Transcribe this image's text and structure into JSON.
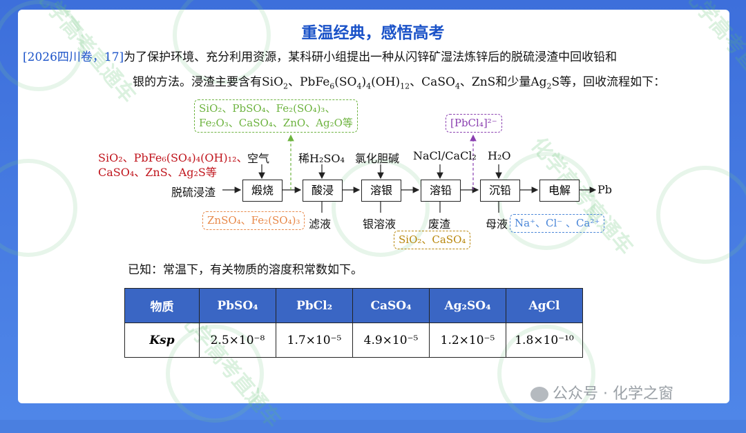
{
  "title": "重温经典，感悟高考",
  "question": {
    "source": "[2026四川卷，17]",
    "line1": "为了保护环境、充分利用资源，某科研小组提出一种从闪锌矿湿法炼锌后的脱硫浸渣中回收铅和",
    "line2_a": "银的方法。浸渣主要含有SiO",
    "line2_b": "、PbFe",
    "line2_c": "(SO",
    "line2_d": ")",
    "line2_e": "(OH)",
    "line2_f": "、CaSO",
    "line2_g": "、ZnS和少量Ag",
    "line2_h": "S等，回收流程如下："
  },
  "flow": {
    "feed_label": "脱硫浸渣",
    "product": "Pb",
    "steps": [
      "煅烧",
      "酸浸",
      "溶银",
      "溶铅",
      "沉铅",
      "电解"
    ],
    "reagents": [
      "空气",
      "稀H₂SO₄",
      "氯化胆碱",
      "NaCl/CaCl₂",
      "H₂O"
    ],
    "outputs": [
      "滤液",
      "银溶液",
      "废渣",
      "母液"
    ],
    "feed_components": [
      "SiO₂、PbFe₆(SO₄)₄(OH)₁₂、",
      "CaSO₄、ZnS、Ag₂S等"
    ],
    "annot_calcine": [
      "SiO₂、PbSO₄、Fe₂(SO₄)₃、",
      "Fe₂O₃、CaSO₄、ZnO、Ag₂O等"
    ],
    "annot_leach": "ZnSO₄、Fe₂(SO₄)₃",
    "annot_residue": "SiO₂、CaSO₄",
    "annot_complex": "[PbCl₄]²⁻",
    "annot_mother": "Na⁺、Cl⁻ 、Ca²⁺",
    "colors": {
      "feed": "#c0141c",
      "calcine": "#6db33f",
      "leach": "#e8894a",
      "residue": "#b8860b",
      "complex": "#8a3fb0",
      "mother": "#4a86d8"
    }
  },
  "known": "已知：常温下，有关物质的溶度积常数如下。",
  "table": {
    "headers": [
      "物质",
      "PbSO₄",
      "PbCl₂",
      "CaSO₄",
      "Ag₂SO₄",
      "AgCl"
    ],
    "row_label": "Ksp",
    "values": [
      "2.5×10⁻⁸",
      "1.7×10⁻⁵",
      "4.9×10⁻⁵",
      "1.2×10⁻⁵",
      "1.8×10⁻¹⁰"
    ]
  },
  "watermark": "化学高考直通车",
  "wechat": "公众号 · 化学之窗"
}
